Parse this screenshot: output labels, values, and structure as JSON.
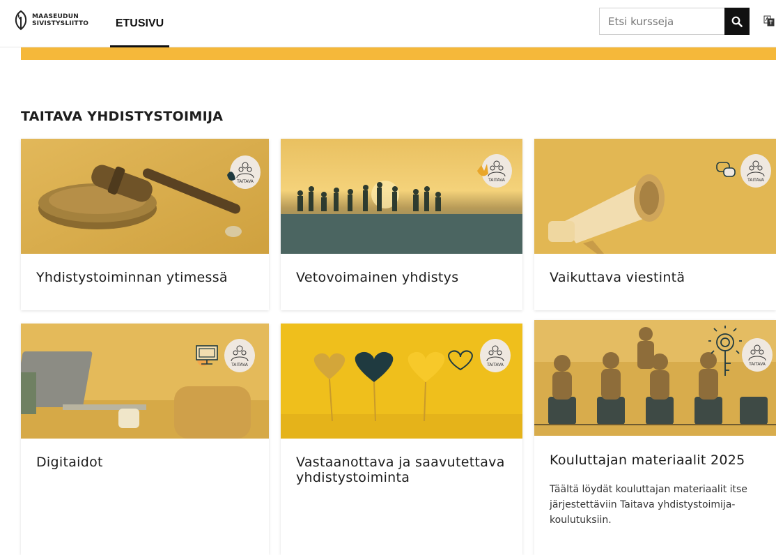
{
  "header": {
    "logo_line1": "MAASEUDUN",
    "logo_line2": "SIVISTYSLIITTO",
    "nav_home": "ETUSIVU",
    "search_placeholder": "Etsi kursseja"
  },
  "section": {
    "title": "TAITAVA YHDISTYSTOIMIJA"
  },
  "badge": {
    "text": "TAITAVA"
  },
  "cards": [
    {
      "title": "Yhdistystoiminnan ytimessä",
      "description": ""
    },
    {
      "title": "Vetovoimainen yhdistys",
      "description": ""
    },
    {
      "title": "Vaikuttava viestintä",
      "description": ""
    },
    {
      "title": "Digitaidot",
      "description": ""
    },
    {
      "title": "Vastaanottava ja saavutettava yhdistystoiminta",
      "description": ""
    },
    {
      "title": "Kouluttajan materiaalit 2025",
      "description": "Täältä löydät kouluttajan materiaalit itse järjestettäviin Taitava yhdistystoimija-koulutuksiin."
    }
  ],
  "colors": {
    "accent": "#f5b83a",
    "image_tint": "#d9ad4a",
    "dark_teal": "#1f3a40"
  },
  "icons": [
    "logo-leaf-icon",
    "search-icon",
    "language-icon",
    "taitava-badge-icon"
  ]
}
